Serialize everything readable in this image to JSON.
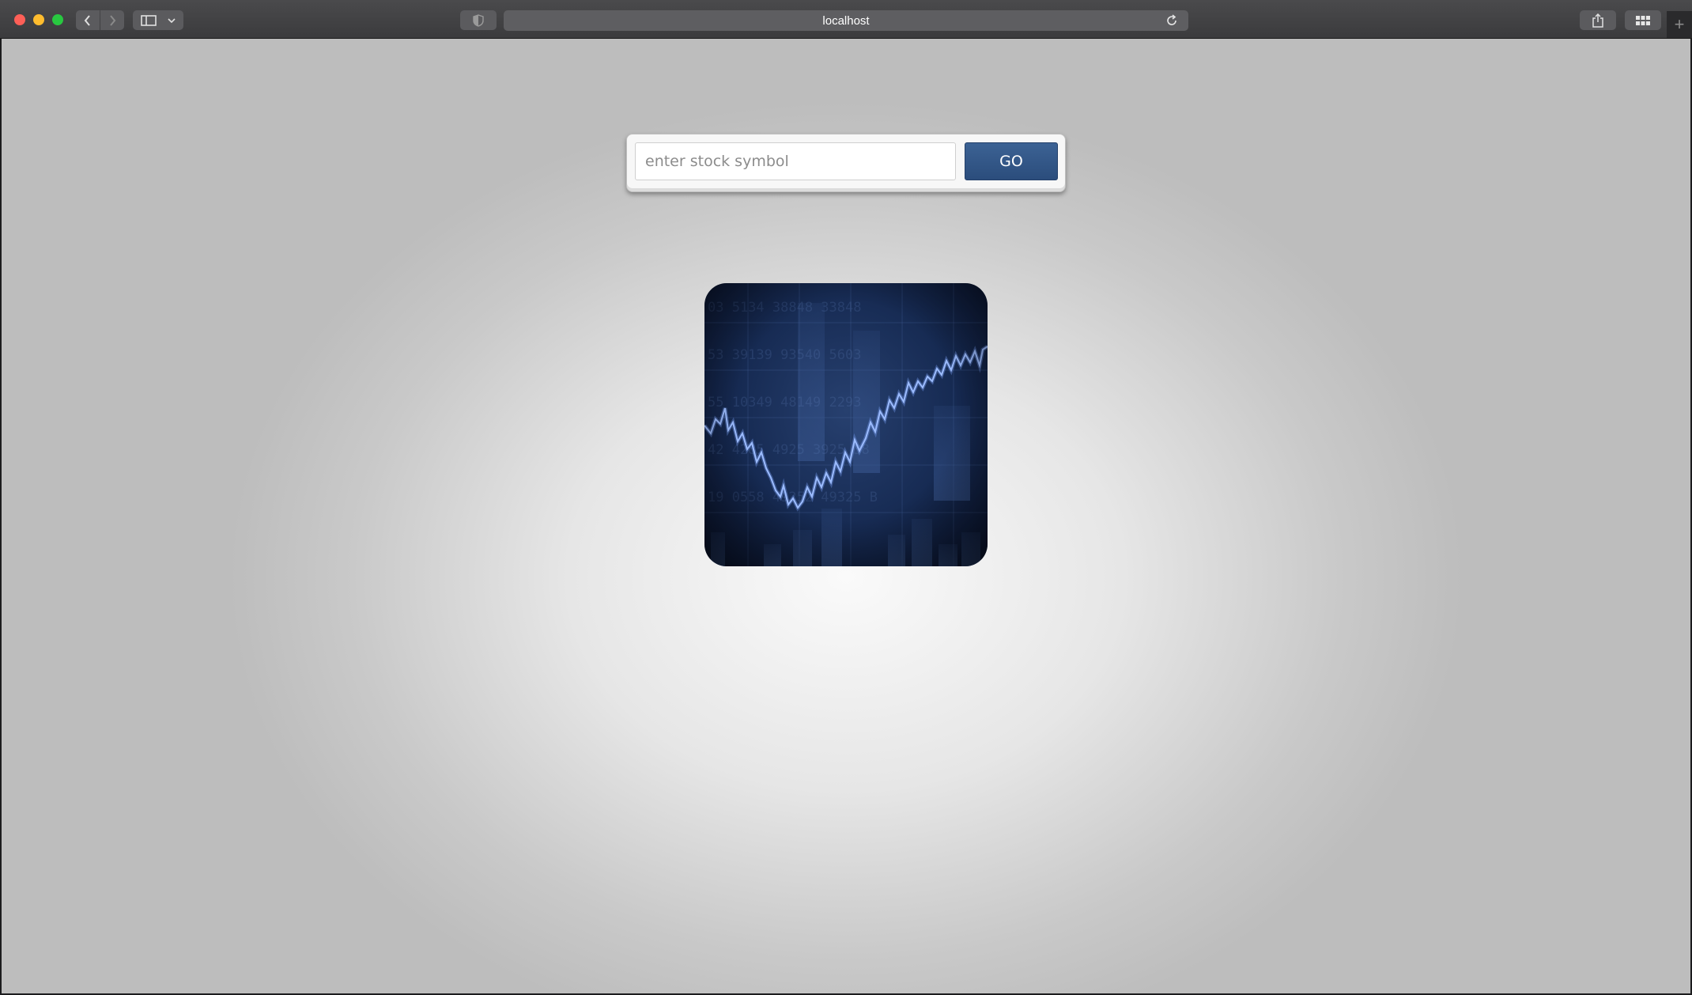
{
  "browser": {
    "url": "localhost"
  },
  "search": {
    "placeholder": "enter stock symbol",
    "value": "",
    "button_label": "GO"
  },
  "hero_image": {
    "icon": "stock-chart-image",
    "colors": {
      "background": "#162a52",
      "line": "#7ea6ff"
    }
  }
}
